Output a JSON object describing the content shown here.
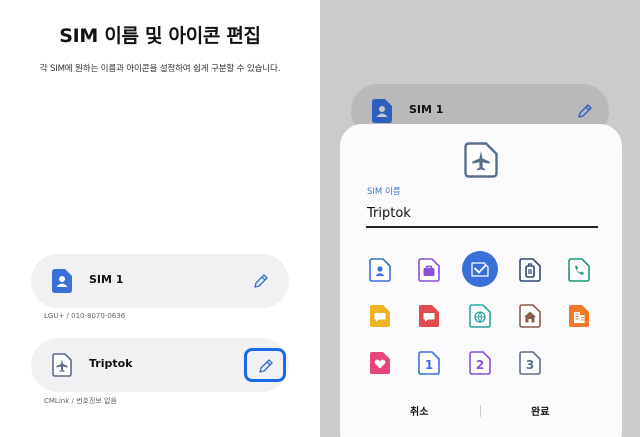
{
  "left": {
    "title": "SIM 이름 및 아이콘 편집",
    "subtitle": "각 SIM에 원하는 이름과 아이콘을 설정하여 쉽게 구분할 수 있습니다.",
    "sims": [
      {
        "name": "SIM 1",
        "sub": "LGU+ / 010-8070-0636",
        "icon": "person-sim-icon"
      },
      {
        "name": "Triptok",
        "sub": "CMLink / 번호정보 없음",
        "icon": "airplane-sim-icon"
      }
    ]
  },
  "right": {
    "bg_sim_name": "SIM 1",
    "dialog": {
      "field_label": "SIM 이름",
      "field_value": "Triptok",
      "cancel": "취소",
      "ok": "완료",
      "selected_icon": "airplane-sim-icon",
      "icons": [
        "person-sim-icon",
        "briefcase-sim-icon",
        "airplane-sim-icon",
        "luggage-sim-icon",
        "phone-sim-icon",
        "chat-yellow-sim-icon",
        "chat-red-sim-icon",
        "globe-sim-icon",
        "home-sim-icon",
        "building-sim-icon",
        "heart-sim-icon",
        "number-1-sim-icon",
        "number-2-sim-icon",
        "number-3-sim-icon"
      ],
      "icon_digits": [
        "1",
        "2",
        "3"
      ]
    }
  },
  "colors": {
    "accent": "#3a6fd8",
    "focus": "#1a6ae8",
    "card_bg": "#f1f1f4",
    "overlay_bg": "#cbcbcd"
  }
}
